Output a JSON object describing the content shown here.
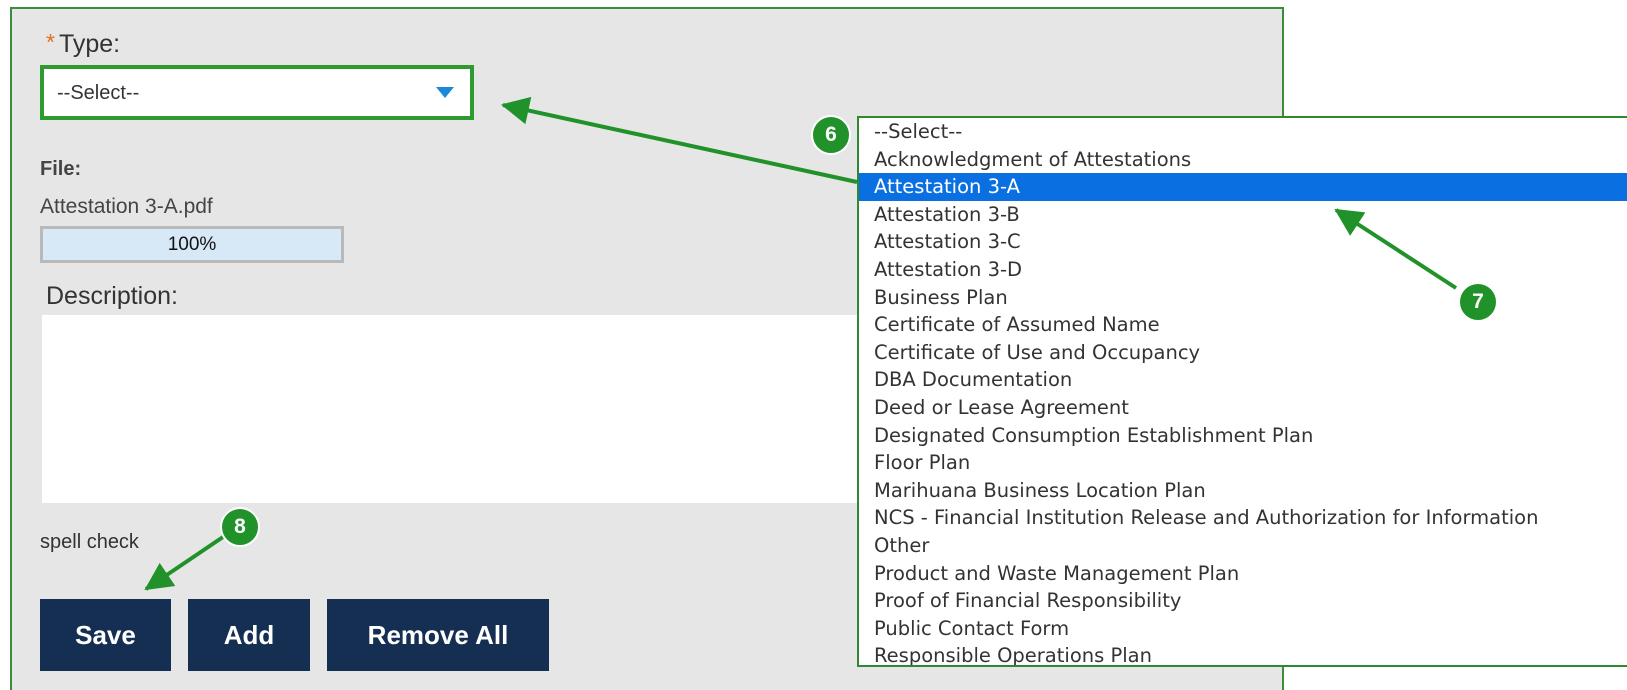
{
  "form": {
    "type_label": "Type:",
    "required_marker": "*",
    "type_select_value": "--Select--",
    "file_label": "File:",
    "file_name": "Attestation 3-A.pdf",
    "upload_progress_text": "100%",
    "upload_progress_fraction": 1.0,
    "description_label": "Description:",
    "description_value": "",
    "spell_check_label": "spell check",
    "save_label": "Save",
    "add_label": "Add",
    "remove_all_label": "Remove All"
  },
  "type_dropdown": {
    "selected_index": 2,
    "options": [
      "--Select--",
      "Acknowledgment of Attestations",
      "Attestation 3-A",
      "Attestation 3-B",
      "Attestation 3-C",
      "Attestation 3-D",
      "Business Plan",
      "Certificate of Assumed Name",
      "Certificate of Use and Occupancy",
      "DBA Documentation",
      "Deed or Lease Agreement",
      "Designated Consumption Establishment Plan",
      "Floor Plan",
      "Marihuana Business Location Plan",
      "NCS - Financial Institution Release and Authorization for Information",
      "Other",
      "Product and Waste Management Plan",
      "Proof of Financial Responsibility",
      "Public Contact Form",
      "Responsible Operations Plan"
    ]
  },
  "annotations": {
    "step_6": "6",
    "step_7": "7",
    "step_8": "8"
  },
  "colors": {
    "panel_background": "#e6e6e6",
    "highlight_green": "#2f9a2f",
    "button_navy": "#152f52",
    "selected_option_blue": "#0a6fe0",
    "required_star_orange": "#e07020",
    "select_caret_blue": "#1e88d8"
  }
}
